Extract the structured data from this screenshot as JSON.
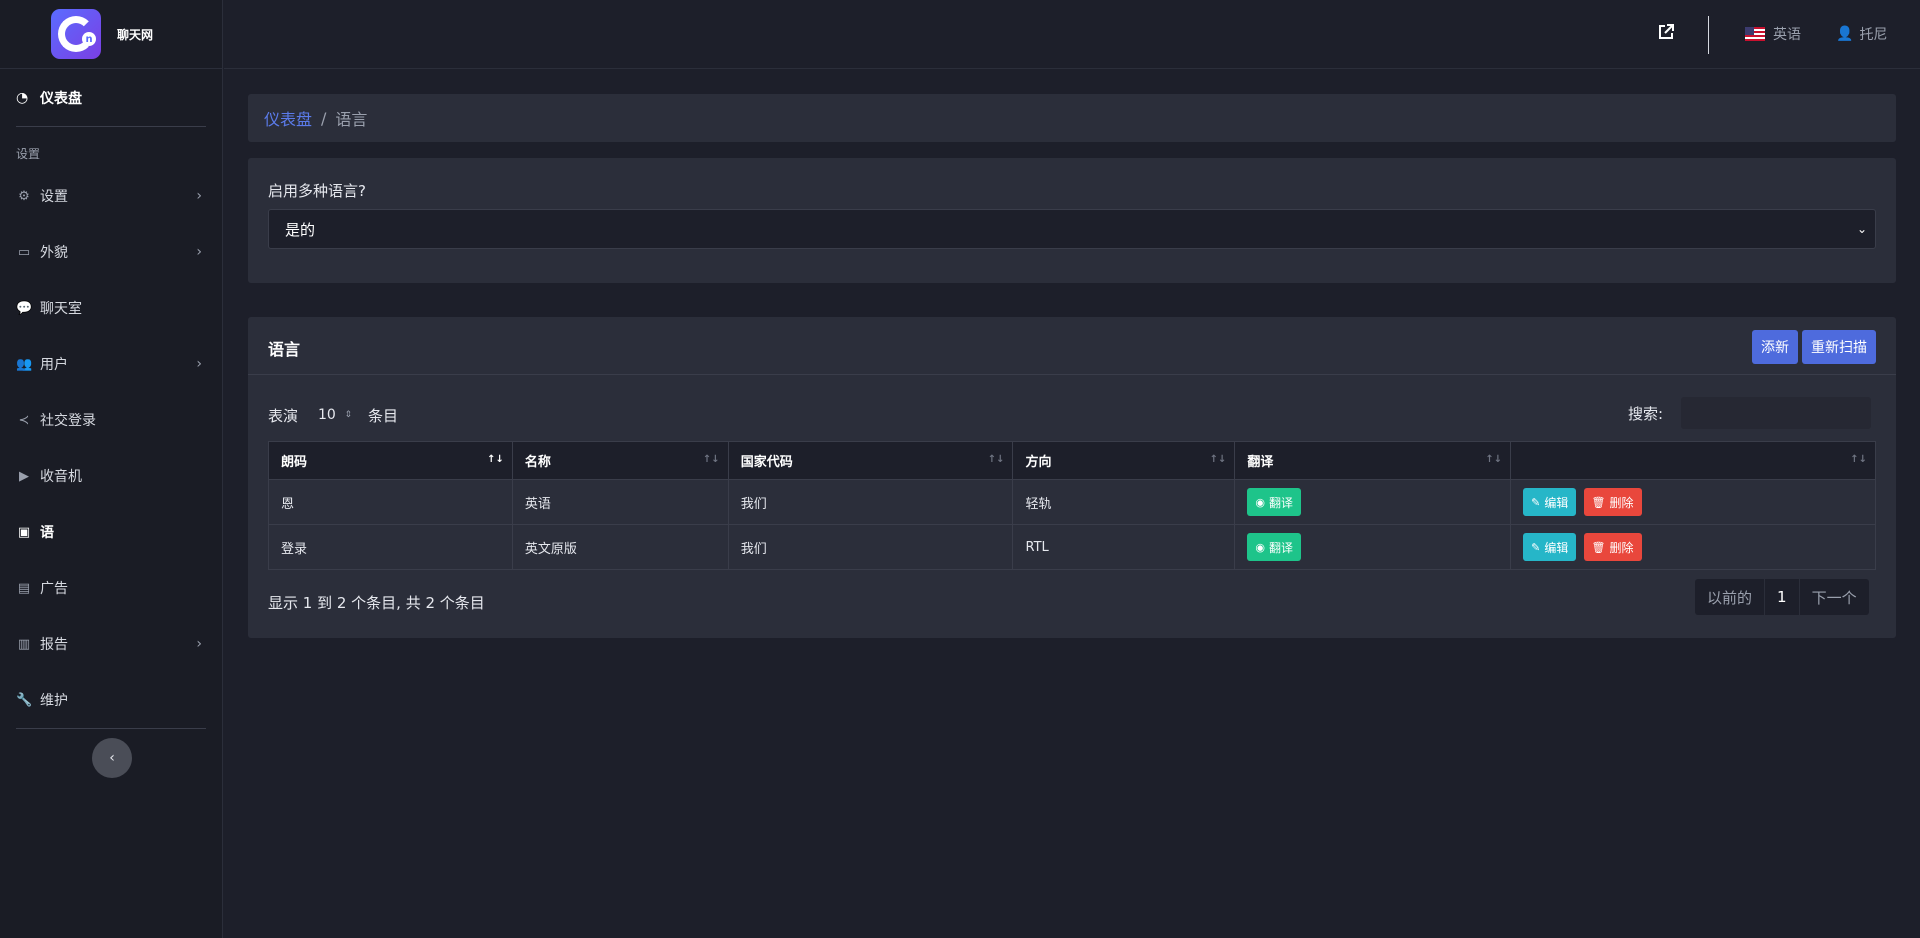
{
  "brand": {
    "name": "聊天网"
  },
  "sidebar": {
    "dashboard": "仪表盘",
    "section": "设置",
    "items": [
      {
        "label": "设置",
        "icon": "gear-icon",
        "chevron": true
      },
      {
        "label": "外貌",
        "icon": "appearance-icon",
        "chevron": true
      },
      {
        "label": "聊天室",
        "icon": "chat-icon",
        "chevron": false
      },
      {
        "label": "用户",
        "icon": "users-icon",
        "chevron": true
      },
      {
        "label": "社交登录",
        "icon": "share-icon",
        "chevron": false
      },
      {
        "label": "收音机",
        "icon": "radio-icon",
        "chevron": false
      },
      {
        "label": "语",
        "icon": "language-icon",
        "chevron": false,
        "active": true
      },
      {
        "label": "广告",
        "icon": "ad-icon",
        "chevron": false
      },
      {
        "label": "报告",
        "icon": "chart-icon",
        "chevron": true
      },
      {
        "label": "维护",
        "icon": "wrench-icon",
        "chevron": false
      }
    ]
  },
  "topbar": {
    "language": "英语",
    "user": "托尼"
  },
  "breadcrumb": {
    "home": "仪表盘",
    "current": "语言"
  },
  "multi_lang": {
    "label": "启用多种语言?",
    "value": "是的"
  },
  "languages": {
    "title": "语言",
    "add": "添新",
    "rescan": "重新扫描",
    "show_prefix": "表演",
    "page_size": "10",
    "show_suffix": "条目",
    "search_label": "搜索:",
    "columns": [
      "朗码",
      "名称",
      "国家代码",
      "方向",
      "翻译",
      ""
    ],
    "rows": [
      {
        "code": "恩",
        "name": "英语",
        "country": "我们",
        "direction": "轻轨"
      },
      {
        "code": "登录",
        "name": "英文原版",
        "country": "我们",
        "direction": "RTL"
      }
    ],
    "translate": "翻译",
    "edit": "编辑",
    "delete": "删除",
    "info": "显示 1 到 2 个条目, 共 2 个条目",
    "prev": "以前的",
    "page": "1",
    "next": "下一个"
  }
}
